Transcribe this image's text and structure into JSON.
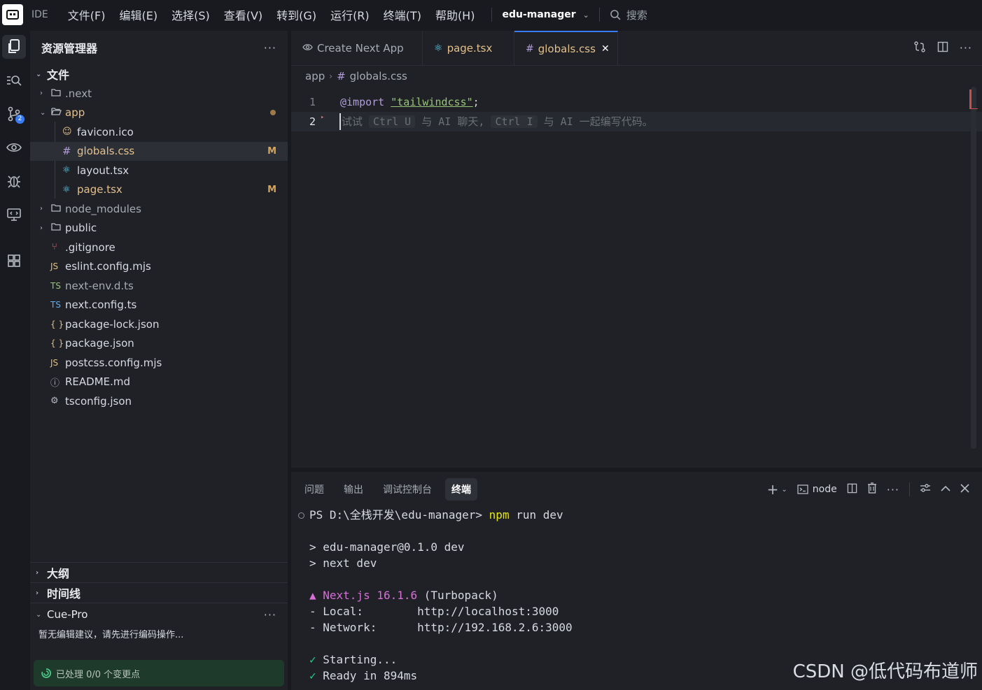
{
  "titlebar": {
    "ide_label": "IDE",
    "menu": [
      "文件(F)",
      "编辑(E)",
      "选择(S)",
      "查看(V)",
      "转到(G)",
      "运行(R)",
      "终端(T)",
      "帮助(H)"
    ],
    "project": "edu-manager",
    "search": "搜索"
  },
  "activity": {
    "source_control_badge": "2"
  },
  "sidebar": {
    "title": "资源管理器",
    "files_section": "文件",
    "tree": [
      {
        "name": ".next",
        "icon": "folder-icon",
        "status": ""
      },
      {
        "name": "app",
        "icon": "folder-open-icon",
        "status": "dot"
      },
      {
        "name": "favicon.ico",
        "icon": "favicon-icon",
        "status": ""
      },
      {
        "name": "globals.css",
        "icon": "css-hash-icon",
        "status": "M"
      },
      {
        "name": "layout.tsx",
        "icon": "react-icon",
        "status": ""
      },
      {
        "name": "page.tsx",
        "icon": "react-icon",
        "status": "M"
      },
      {
        "name": "node_modules",
        "icon": "folder-icon",
        "status": ""
      },
      {
        "name": "public",
        "icon": "folder-icon",
        "status": ""
      },
      {
        "name": ".gitignore",
        "icon": "git-icon",
        "status": ""
      },
      {
        "name": "eslint.config.mjs",
        "icon": "js-icon",
        "status": ""
      },
      {
        "name": "next-env.d.ts",
        "icon": "ts-icon",
        "status": ""
      },
      {
        "name": "next.config.ts",
        "icon": "ts-icon",
        "status": ""
      },
      {
        "name": "package-lock.json",
        "icon": "json-icon",
        "status": ""
      },
      {
        "name": "package.json",
        "icon": "json-icon",
        "status": ""
      },
      {
        "name": "postcss.config.mjs",
        "icon": "js-icon",
        "status": ""
      },
      {
        "name": "README.md",
        "icon": "info-icon",
        "status": ""
      },
      {
        "name": "tsconfig.json",
        "icon": "gear-icon",
        "status": ""
      }
    ],
    "outline": "大纲",
    "timeline": "时间线",
    "cue_pro": "Cue-Pro",
    "cue_message": "暂无编辑建议，请先进行编码操作...",
    "cue_status": "已处理 0/0 个变更点"
  },
  "editor": {
    "tabs": [
      {
        "label": "Create Next App",
        "icon": "eye-icon",
        "active": false
      },
      {
        "label": "page.tsx",
        "icon": "react-icon",
        "active": false
      },
      {
        "label": "globals.css",
        "icon": "css-hash-icon",
        "active": true
      }
    ],
    "breadcrumb": [
      "app",
      "globals.css"
    ],
    "lines": [
      {
        "num": "1",
        "keyword": "@import",
        "string": "\"tailwindcss\"",
        "end": ";"
      },
      {
        "num": "2",
        "hint_pre": "试试 ",
        "kbd1": "Ctrl U",
        "hint_mid": " 与 AI 聊天, ",
        "kbd2": "Ctrl I",
        "hint_post": " 与 AI 一起编写代码。"
      }
    ]
  },
  "panel": {
    "tabs": [
      "问题",
      "输出",
      "调试控制台",
      "终端"
    ],
    "active_tab": "终端",
    "shell": "node",
    "terminal": {
      "prompt": "PS D:\\全栈开发\\edu-manager> ",
      "cmd_npm": "npm",
      "cmd_rest": " run dev",
      "l1": "> edu-manager@0.1.0 dev",
      "l2": "> next dev",
      "next_mark": "▲ ",
      "next_name": "Next.js 16.1.6",
      "next_tail": " (Turbopack)",
      "local_label": "- Local:        ",
      "local_url": "http://localhost:3000",
      "network_label": "- Network:      ",
      "network_url": "http://192.168.2.6:3000",
      "check": "✓",
      "starting": " Starting...",
      "ready": " Ready in 894ms"
    }
  },
  "watermark": "CSDN @低代码布道师",
  "colors": {
    "accent": "#3a7cf5",
    "modified": "#d3a45a",
    "tab_active_text": "#e2c08d"
  }
}
